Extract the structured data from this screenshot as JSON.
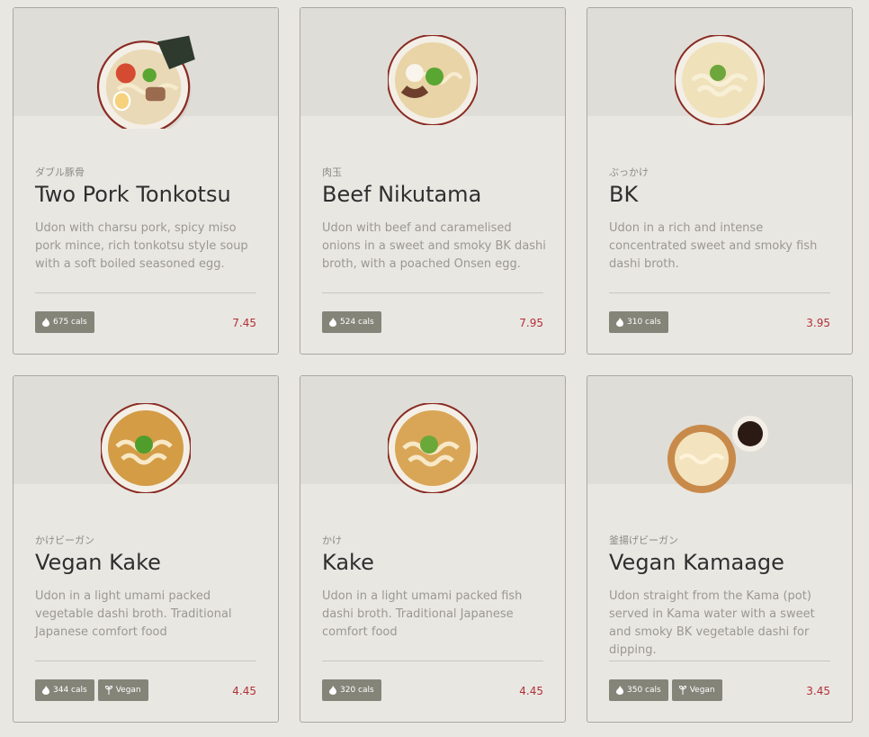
{
  "menu": {
    "items": [
      {
        "jp": "ダブル豚骨",
        "name": "Two Pork Tonkotsu",
        "desc": "Udon with charsu pork, spicy miso pork mince, rich tonkotsu style soup with a soft boiled seasoned egg.",
        "cals": "675 cals",
        "vegan": "",
        "price": "7.45",
        "dish": "tonkotsu-bowl"
      },
      {
        "jp": "肉玉",
        "name": "Beef Nikutama",
        "desc": "Udon with beef and caramelised onions in a sweet and smoky BK dashi broth, with a poached Onsen egg.",
        "cals": "524 cals",
        "vegan": "",
        "price": "7.95",
        "dish": "beef-bowl"
      },
      {
        "jp": "ぶっかけ",
        "name": "BK",
        "desc": "Udon in a rich and intense concentrated sweet and smoky fish dashi broth.",
        "cals": "310 cals",
        "vegan": "",
        "price": "3.95",
        "dish": "bukkake-bowl"
      },
      {
        "jp": "かけビーガン",
        "name": "Vegan Kake",
        "desc": "Udon in a light umami packed vegetable dashi broth. Traditional Japanese comfort food",
        "cals": "344 cals",
        "vegan": "Vegan",
        "price": "4.45",
        "dish": "kake-bowl"
      },
      {
        "jp": "かけ",
        "name": "Kake",
        "desc": "Udon in a light umami packed fish dashi broth. Traditional Japanese comfort food",
        "cals": "320 cals",
        "vegan": "",
        "price": "4.45",
        "dish": "kake-bowl"
      },
      {
        "jp": "釜揚げビーガン",
        "name": "Vegan Kamaage",
        "desc": "Udon straight from the Kama (pot) served in Kama water with a sweet and smoky BK vegetable dashi for dipping.",
        "cals": "350 cals",
        "vegan": "Vegan",
        "price": "3.45",
        "dish": "kamaage-bowl"
      }
    ]
  }
}
